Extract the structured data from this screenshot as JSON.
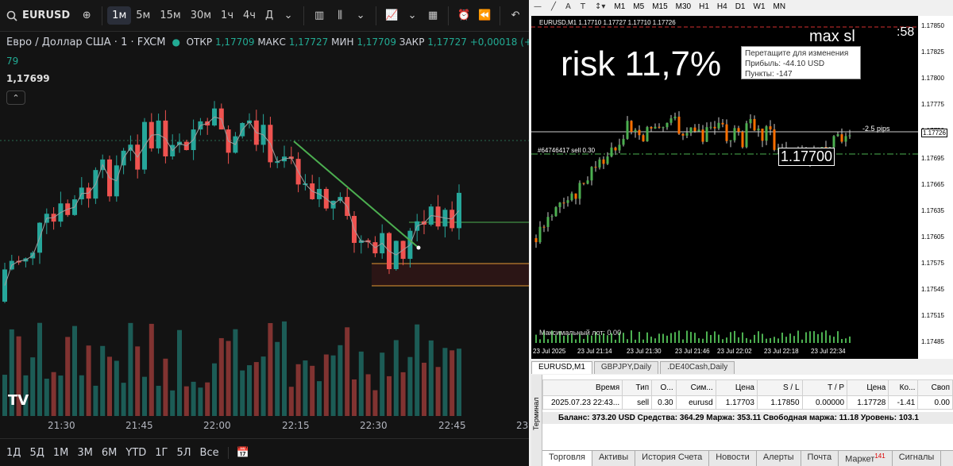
{
  "tradingview": {
    "toolbar": {
      "symbol": "EURUSD",
      "timeframes": [
        "1м",
        "5м",
        "15м",
        "30м",
        "1ч",
        "4ч",
        "Д"
      ],
      "active_timeframe": "1м"
    },
    "legend": {
      "title": "Евро / Доллар США · 1 · FXCM",
      "open_label": "ОТКР",
      "open": "1,17709",
      "high_label": "МАКС",
      "high": "1,17727",
      "low_label": "МИН",
      "low": "1,17709",
      "close_label": "ЗАКР",
      "close": "1,17727",
      "change": "+0,00018 (+0",
      "sub": "79",
      "indicator_value": "1,17699"
    },
    "time_labels": [
      "21:30",
      "21:45",
      "22:00",
      "22:15",
      "22:30",
      "22:45"
    ],
    "time_label_tail": "23",
    "ranges": [
      "1Д",
      "5Д",
      "1М",
      "3М",
      "6М",
      "YTD",
      "1Г",
      "5Л",
      "Все"
    ],
    "logo": "TV",
    "colors": {
      "up": "#26a69a",
      "down": "#ef5350",
      "trend": "#4caf50"
    }
  },
  "mt4": {
    "toolbar": {
      "timeframes": [
        "M1",
        "M5",
        "M15",
        "M30",
        "H1",
        "H4",
        "D1",
        "W1",
        "MN"
      ]
    },
    "chart_title": "EURUSD,M1  1.17710 1.17727 1.17710 1.17726",
    "overlay_risk": "risk 11,7%",
    "overlay_maxsl": "max sl",
    "timer": ":58",
    "tooltip": [
      "Перетащите для изменения",
      "Прибыль: -44.10 USD",
      "Пункты: -147"
    ],
    "pips_label": "-2.5 pips",
    "order_label": "#64746417 sell 0.30",
    "entry_price_box": "1.17700",
    "max_lot": "Максимальный лот: 0.00",
    "price_axis": [
      "1.17850",
      "1.17825",
      "1.17800",
      "1.17775",
      "1.17750",
      "1.17726",
      "1.17695",
      "1.17665",
      "1.17635",
      "1.17605",
      "1.17575",
      "1.17545",
      "1.17515",
      "1.17485"
    ],
    "time_axis": [
      "23 Jul 2025",
      "23 Jul 21:14",
      "23 Jul 21:30",
      "23 Jul 21:46",
      "23 Jul 22:02",
      "23 Jul 22:18",
      "23 Jul 22:34"
    ],
    "chart_tabs": [
      "EURUSD,M1",
      "GBPJPY,Daily",
      ".DE40Cash,Daily"
    ],
    "terminal": {
      "vertical_label": "Терминал",
      "headers": [
        "Время",
        "Тип",
        "О...",
        "Сим...",
        "Цена",
        "S / L",
        "T / P",
        "Цена",
        "Ко...",
        "Своп"
      ],
      "row": [
        "2025.07.23 22:43...",
        "sell",
        "0.30",
        "eurusd",
        "1.17703",
        "1.17850",
        "0.00000",
        "1.17728",
        "-1.41",
        "0.00"
      ],
      "balance_line": "Баланс: 373.20 USD  Средства: 364.29  Маржа: 353.11  Свободная маржа: 11.18  Уровень: 103.1",
      "bottom_tabs": [
        "Торговля",
        "Активы",
        "История Счета",
        "Новости",
        "Алерты",
        "Почта",
        "Маркет",
        "Сигналы"
      ],
      "market_badge": "141"
    }
  }
}
